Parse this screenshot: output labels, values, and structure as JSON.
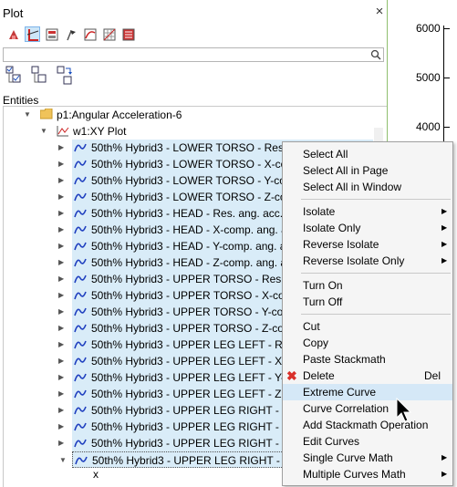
{
  "panel": {
    "title": "Plot",
    "close_icon": "×",
    "search_value": "",
    "entities_label": "Entities"
  },
  "toolbar": {
    "icons": [
      "plot-options-icon",
      "axis-icon",
      "page-layout-icon",
      "marker-icon",
      "curve-style-icon",
      "grid-icon",
      "legend-icon"
    ],
    "tree_tools": [
      "expand-all-icon",
      "collapse-all-icon",
      "sync-tree-icon"
    ]
  },
  "tree": {
    "page": "p1:Angular Acceleration-6",
    "window": "w1:XY Plot",
    "curves": [
      "50th% Hybrid3   - LOWER TORSO - Res. ang. acc.",
      "50th% Hybrid3   - LOWER TORSO - X-comp.",
      "50th% Hybrid3   - LOWER TORSO - Y-comp.",
      "50th% Hybrid3   - LOWER TORSO - Z-comp.",
      "50th% Hybrid3   - HEAD - Res. ang. acc.",
      "50th% Hybrid3   - HEAD - X-comp. ang. acc.",
      "50th% Hybrid3   - HEAD - Y-comp. ang. acc.",
      "50th% Hybrid3   - HEAD - Z-comp. ang. acc.",
      "50th% Hybrid3   - UPPER TORSO - Res. ang.",
      "50th% Hybrid3   - UPPER TORSO - X-comp.",
      "50th% Hybrid3   - UPPER TORSO - Y-comp.",
      "50th% Hybrid3   - UPPER TORSO - Z-comp.",
      "50th% Hybrid3   - UPPER LEG LEFT - Res. a",
      "50th% Hybrid3   - UPPER LEG LEFT - X-com",
      "50th% Hybrid3   - UPPER LEG LEFT - Y-com",
      "50th% Hybrid3   - UPPER LEG LEFT - Z-com",
      "50th% Hybrid3   - UPPER LEG RIGHT - Res",
      "50th% Hybrid3   - UPPER LEG RIGHT - X-c",
      "50th% Hybrid3   - UPPER LEG RIGHT - Y-c",
      "50th% Hybrid3   - UPPER LEG RIGHT - Z-co"
    ],
    "child": "x"
  },
  "plot_axis": {
    "ticks": [
      "6000",
      "5000",
      "4000"
    ]
  },
  "context_menu": {
    "items": [
      {
        "label": "Select All"
      },
      {
        "label": "Select All in Page"
      },
      {
        "label": "Select All in Window"
      },
      {
        "label": "Isolate",
        "submenu": true
      },
      {
        "label": "Isolate Only",
        "submenu": true
      },
      {
        "label": "Reverse Isolate",
        "submenu": true
      },
      {
        "label": "Reverse Isolate Only",
        "submenu": true
      },
      {
        "label": "Turn On"
      },
      {
        "label": "Turn Off"
      },
      {
        "label": "Cut"
      },
      {
        "label": "Copy"
      },
      {
        "label": "Paste Stackmath"
      },
      {
        "label": "Delete",
        "shortcut": "Del",
        "icon": "delete-x-icon"
      },
      {
        "label": "Extreme Curve",
        "highlighted": true
      },
      {
        "label": "Curve Correlation"
      },
      {
        "label": "Add Stackmath Operation"
      },
      {
        "label": "Edit Curves"
      },
      {
        "label": "Single Curve Math",
        "submenu": true
      },
      {
        "label": "Multiple Curves Math",
        "submenu": true
      }
    ]
  },
  "colors": {
    "selection": "#d9ecf8",
    "menu_highlight": "#d5e8f7",
    "curve_icon": "#1f3fbf",
    "delete_icon": "#d9302a"
  }
}
